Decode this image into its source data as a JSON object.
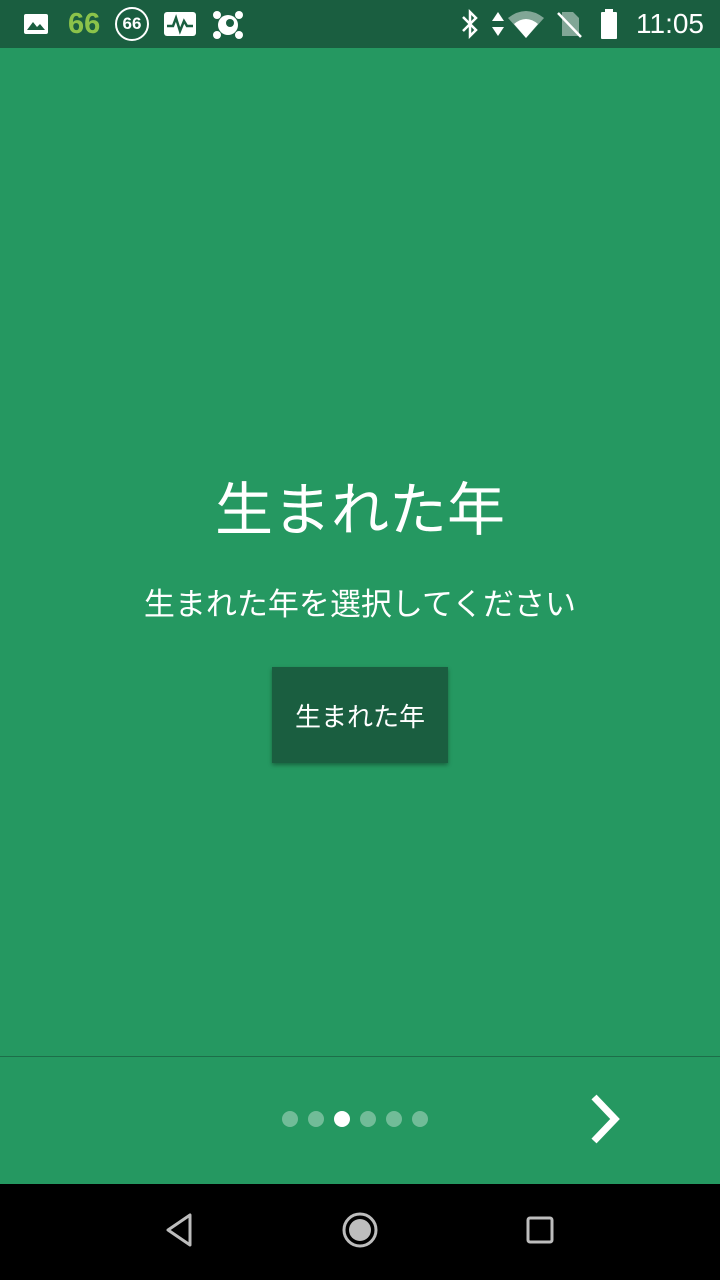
{
  "status_bar": {
    "notification_count": "66",
    "circle_count": "66",
    "time": "11:05",
    "icons": [
      "image-icon",
      "activity-icon",
      "antivirus-icon",
      "bluetooth-icon",
      "data-arrows-icon",
      "wifi-icon",
      "no-sim-icon",
      "battery-icon"
    ]
  },
  "page": {
    "title": "生まれた年",
    "description": "生まれた年を選択してください",
    "button_label": "生まれた年"
  },
  "pager": {
    "total": 6,
    "active_index": 2
  },
  "colors": {
    "background": "#259861",
    "status_bar": "#1a5e40",
    "button": "#1a5e40",
    "nav_bar": "#000000"
  }
}
